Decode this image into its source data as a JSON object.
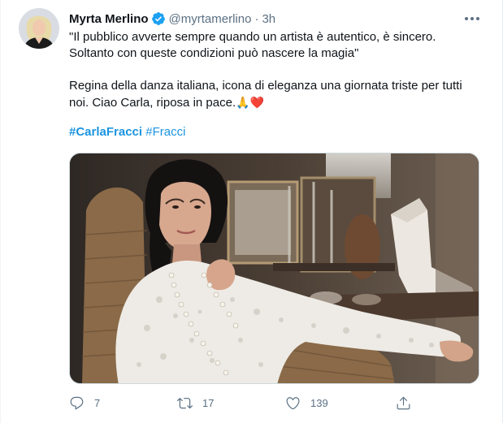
{
  "tweet": {
    "author": {
      "name": "Myrta Merlino",
      "handle": "@myrtamerlino",
      "separator": "·",
      "time": "3h",
      "verified": true,
      "avatar_icon": "avatar-photo"
    },
    "text": {
      "paragraph1": "\"Il pubblico avverte sempre quando un artista è autentico, è sincero.\nSoltanto con queste condizioni può nascere la magia\"",
      "paragraph2": "Regina della danza italiana, icona di eleganza una giornata triste per tutti\nnoi. Ciao Carla, riposa in pace.",
      "emoji": "🙏❤️"
    },
    "hashtags": [
      "#CarlaFracci",
      "#Fracci"
    ],
    "media": {
      "type": "photo"
    },
    "actions": {
      "reply": {
        "icon": "reply-icon",
        "count": "7"
      },
      "retweet": {
        "icon": "retweet-icon",
        "count": "17"
      },
      "like": {
        "icon": "heart-icon",
        "count": "139"
      },
      "share": {
        "icon": "share-icon"
      }
    }
  },
  "colors": {
    "link": "#1b95e0",
    "secondary_text": "#5b7083",
    "verified": "#1da1f2"
  }
}
